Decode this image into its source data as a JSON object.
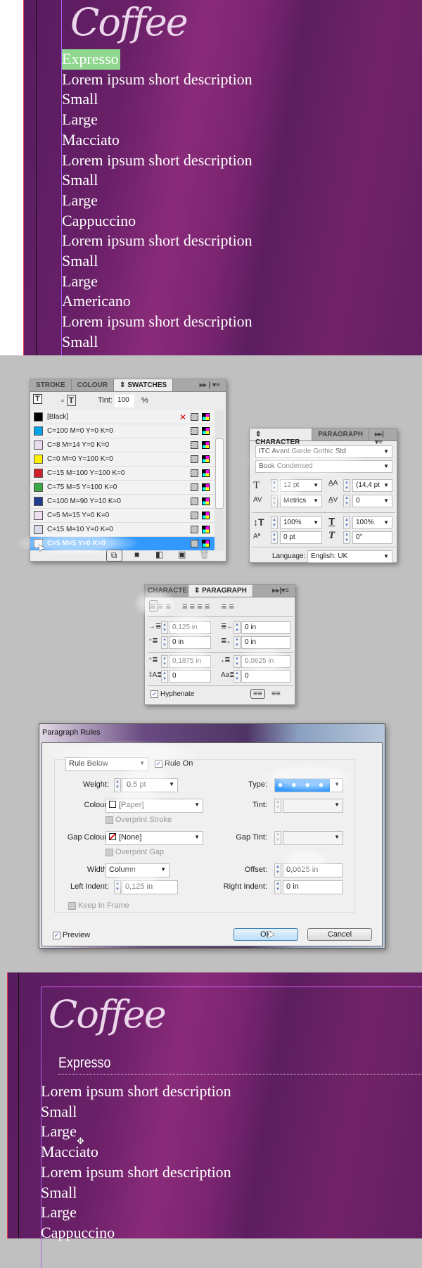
{
  "top_layout": {
    "title": "Coffee",
    "lines": [
      "Expresso",
      "Lorem ipsum short description",
      "Small",
      "Large",
      "Macciato",
      "Lorem ipsum short description",
      "Small",
      "Large",
      "Cappuccino",
      "Lorem ipsum short description",
      "Small",
      "Large",
      "Americano",
      "Lorem ipsum short description",
      "Small"
    ],
    "highlight_color": "#8fd68f"
  },
  "swatches_panel": {
    "tabs": [
      "STROKE",
      "COLOUR",
      "SWATCHES"
    ],
    "active_tab": "SWATCHES",
    "tint_label": "Tint:",
    "tint_value": "100",
    "tint_unit": "%",
    "swatches": [
      {
        "name": "[Black]",
        "color": "#000000"
      },
      {
        "name": "C=100 M=0 Y=0 K=0",
        "color": "#00a0e6"
      },
      {
        "name": "C=8 M=14 Y=0 K=0",
        "color": "#e8dcee"
      },
      {
        "name": "C=0 M=0 Y=100 K=0",
        "color": "#fff000"
      },
      {
        "name": "C=15 M=100 Y=100 K=0",
        "color": "#d0202a"
      },
      {
        "name": "C=75 M=5 Y=100 K=0",
        "color": "#3aa845"
      },
      {
        "name": "C=100 M=90 Y=10 K=0",
        "color": "#203c8c"
      },
      {
        "name": "C=5 M=15 Y=0 K=0",
        "color": "#f0dff0"
      },
      {
        "name": "C=15 M=10 Y=0 K=0",
        "color": "#d8dcec"
      },
      {
        "name": "C=5 M=5 Y=0 K=0",
        "color": "#eeeef6",
        "selected": true
      }
    ]
  },
  "character_panel": {
    "tabs": [
      "CHARACTER",
      "PARAGRAPH"
    ],
    "font_family": "ITC Avant Garde Gothic Std",
    "font_style": "Book Condensed",
    "size": "12 pt",
    "leading": "(14,4 pt",
    "kerning": "Metrics",
    "tracking": "0",
    "vertical_scale": "100%",
    "horizontal_scale": "100%",
    "baseline_shift": "0 pt",
    "skew": "0°",
    "language_label": "Language:",
    "language": "English: UK"
  },
  "paragraph_panel": {
    "tabs": [
      "CHARACTER",
      "PARAGRAPH"
    ],
    "left_indent": "0,125 in",
    "right_indent": "0 in",
    "first_line_indent": "0 in",
    "last_line_indent": "0 in",
    "space_before": "0,1875 in",
    "space_after": "0,0625 in",
    "drop_cap_lines": "0",
    "drop_cap_chars": "0",
    "hyphenate_label": "Hyphenate",
    "hyphenate": true
  },
  "paragraph_rules_dialog": {
    "title": "Paragraph Rules",
    "rule_select": "Rule Below",
    "rule_on_label": "Rule On",
    "rule_on": true,
    "weight_label": "Weight:",
    "weight": "0,5 pt",
    "type_label": "Type:",
    "type": "dots",
    "colour_label": "Colour:",
    "colour": "[Paper]",
    "tint_label": "Tint:",
    "overprint_stroke_label": "Overprint Stroke",
    "gap_colour_label": "Gap Colour:",
    "gap_colour": "[None]",
    "gap_tint_label": "Gap Tint:",
    "overprint_gap_label": "Overprint Gap",
    "width_label": "Width:",
    "width": "Column",
    "offset_label": "Offset:",
    "offset": "0,0625 in",
    "left_indent_label": "Left Indent:",
    "left_indent": "0,125 in",
    "right_indent_label": "Right Indent:",
    "right_indent": "0 in",
    "keep_in_frame_label": "Keep In Frame",
    "preview_label": "Preview",
    "preview": true,
    "ok_label": "OK",
    "cancel_label": "Cancel",
    "accent": "#3399ff"
  },
  "bottom_layout": {
    "title": "Coffee",
    "heading": "Expresso",
    "lines": [
      "Lorem ipsum short description",
      "Small",
      "Large",
      "Macciato",
      "Lorem ipsum short description",
      "Small",
      "Large",
      "Cappuccino"
    ]
  }
}
